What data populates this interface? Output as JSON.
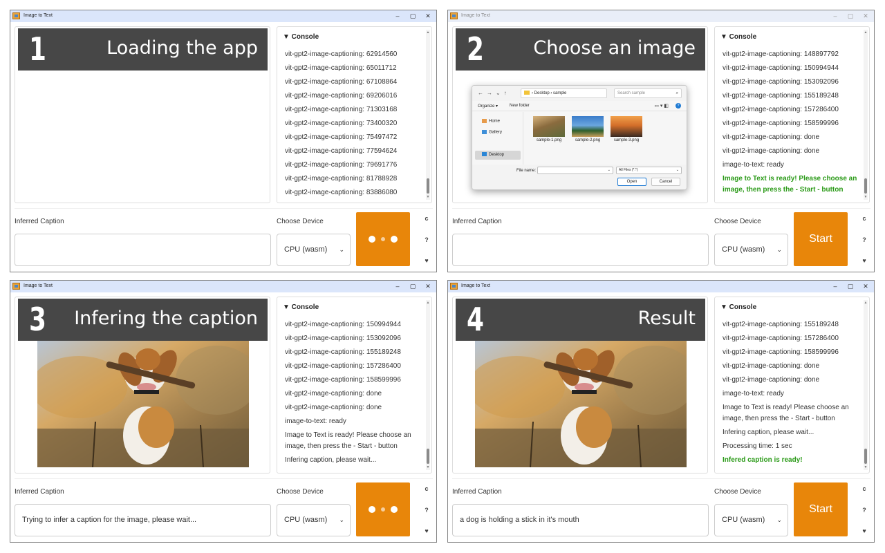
{
  "window_title": "Image to Text",
  "window_controls": {
    "minimize": "–",
    "maximize": "▢",
    "close": "✕"
  },
  "console_header": "▼ Console",
  "labels": {
    "caption": "Inferred Caption",
    "device": "Choose Device"
  },
  "device_value": "CPU (wasm)",
  "start_label": "Start",
  "side_icons": [
    "refresh-icon",
    "help-icon",
    "heart-icon"
  ],
  "accent_color": "#e8860a",
  "panels": [
    {
      "number": "1",
      "title": "Loading the app",
      "caption_value": "",
      "console_lines": [
        "vit-gpt2-image-captioning: 62914560",
        "vit-gpt2-image-captioning: 65011712",
        "vit-gpt2-image-captioning: 67108864",
        "vit-gpt2-image-captioning: 69206016",
        "vit-gpt2-image-captioning: 71303168",
        "vit-gpt2-image-captioning: 73400320",
        "vit-gpt2-image-captioning: 75497472",
        "vit-gpt2-image-captioning: 77594624",
        "vit-gpt2-image-captioning: 79691776",
        "vit-gpt2-image-captioning: 81788928",
        "vit-gpt2-image-captioning: 83886080"
      ]
    },
    {
      "number": "2",
      "title": "Choose an image",
      "caption_value": "",
      "console_lines": [
        "vit-gpt2-image-captioning: 148897792",
        "vit-gpt2-image-captioning: 150994944",
        "vit-gpt2-image-captioning: 153092096",
        "vit-gpt2-image-captioning: 155189248",
        "vit-gpt2-image-captioning: 157286400",
        "vit-gpt2-image-captioning: 158599996",
        "vit-gpt2-image-captioning: done",
        "vit-gpt2-image-captioning: done",
        "image-to-text: ready"
      ],
      "console_highlight": "Image to Text is ready! Please choose an image, then press the - Start - button",
      "file_dialog": {
        "path_segments": "›  Desktop  ›  sample",
        "search_placeholder": "Search sample",
        "organize": "Organize ▾",
        "new_folder": "New folder",
        "nav_items": [
          "Home",
          "Gallery",
          "Desktop"
        ],
        "files": [
          "sample-1.png",
          "sample-2.png",
          "sample-3.png"
        ],
        "file_name_label": "File name:",
        "file_type": "All Files (*.*)",
        "open": "Open",
        "cancel": "Cancel"
      }
    },
    {
      "number": "3",
      "title": "Infering the caption",
      "caption_value": "Trying to infer a caption for the image, please wait...",
      "console_lines": [
        "vit-gpt2-image-captioning: 150994944",
        "vit-gpt2-image-captioning: 153092096",
        "vit-gpt2-image-captioning: 155189248",
        "vit-gpt2-image-captioning: 157286400",
        "vit-gpt2-image-captioning: 158599996",
        "vit-gpt2-image-captioning: done",
        "vit-gpt2-image-captioning: done",
        "image-to-text: ready"
      ],
      "console_wrapped": "Image to Text is ready! Please choose an image, then press the - Start - button",
      "console_tail": "Infering caption, please wait..."
    },
    {
      "number": "4",
      "title": "Result",
      "caption_value": "a dog is holding a stick in it's mouth",
      "console_lines": [
        "vit-gpt2-image-captioning: 155189248",
        "vit-gpt2-image-captioning: 157286400",
        "vit-gpt2-image-captioning: 158599996",
        "vit-gpt2-image-captioning: done",
        "vit-gpt2-image-captioning: done",
        "image-to-text: ready"
      ],
      "console_wrapped": "Image to Text is ready! Please choose an image, then press the - Start - button",
      "console_tail_lines": [
        "Infering caption, please wait...",
        "Processing time: 1 sec"
      ],
      "console_highlight": "Infered caption is ready!"
    }
  ]
}
